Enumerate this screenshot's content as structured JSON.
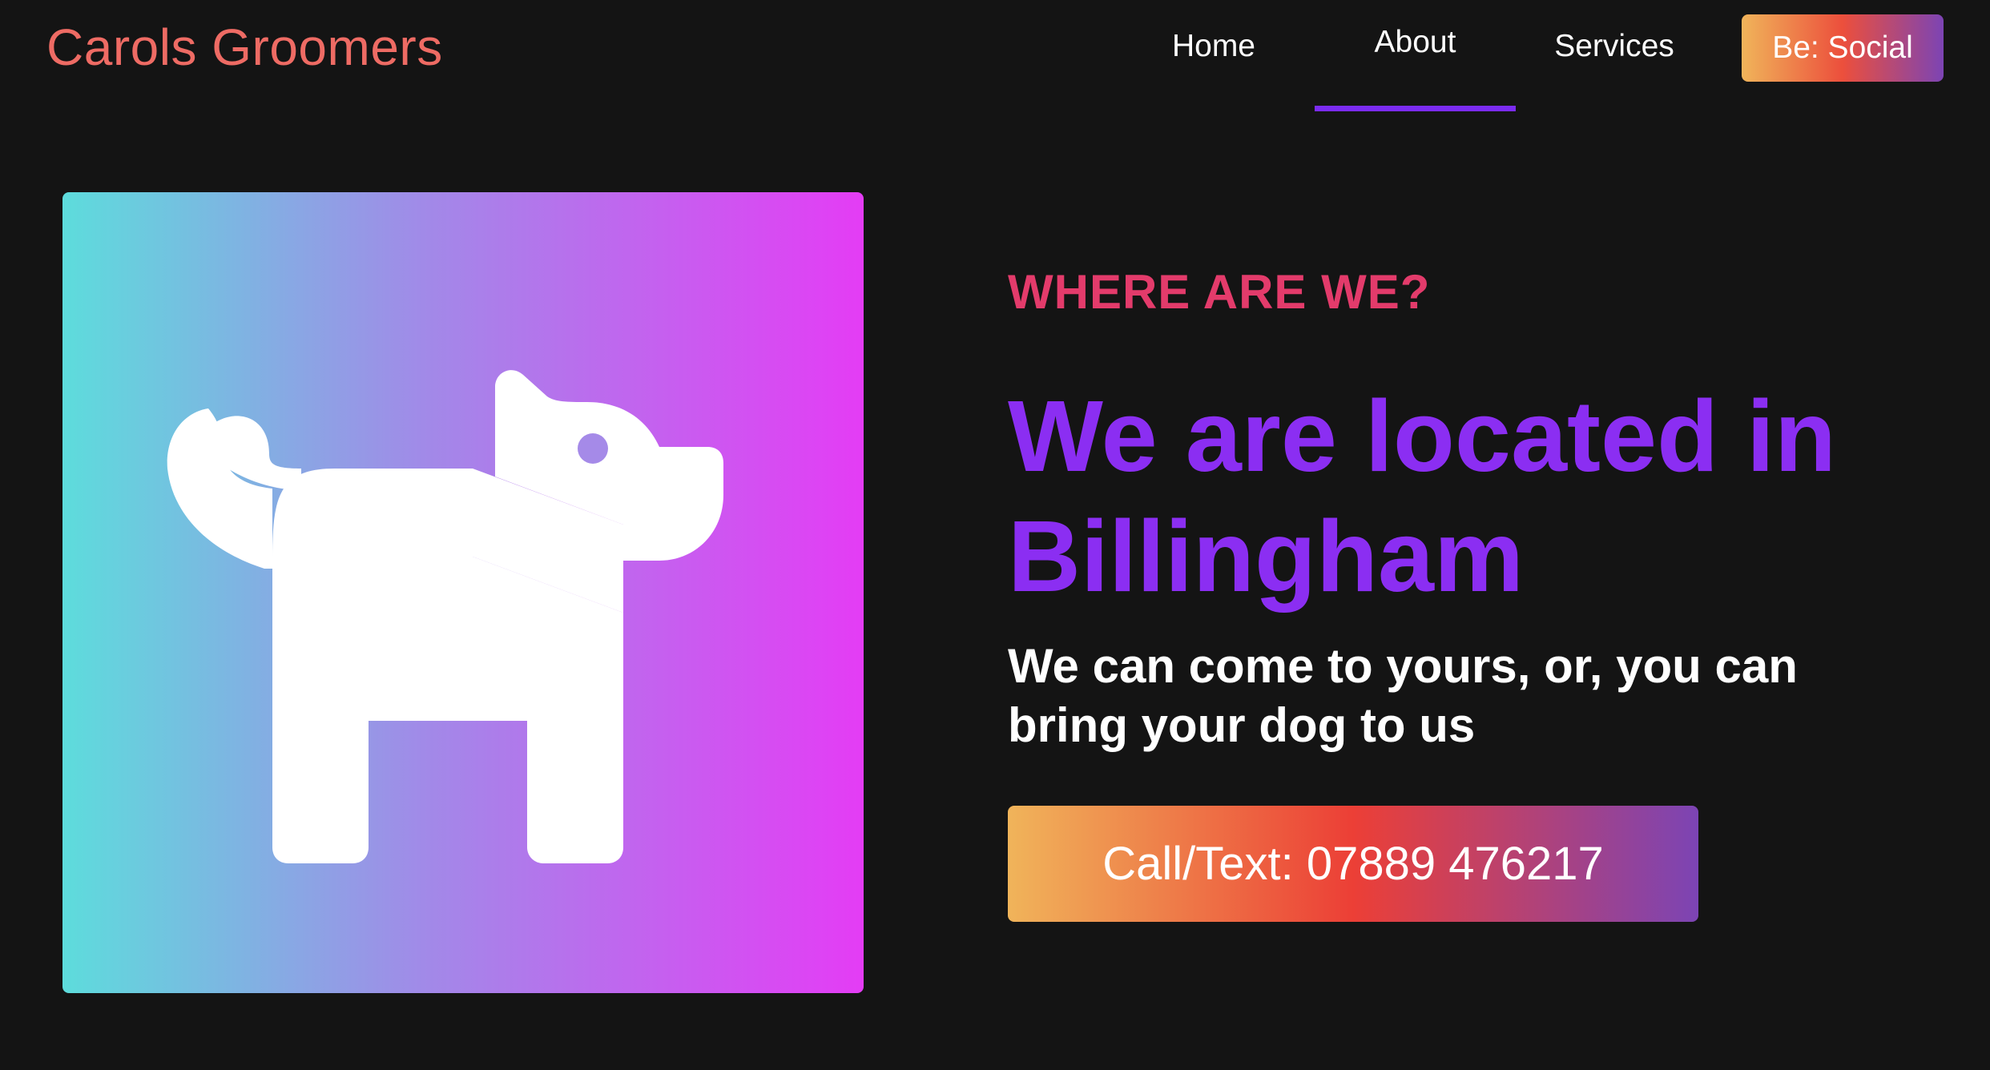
{
  "header": {
    "logo": "Carols Groomers",
    "nav": {
      "home": "Home",
      "about": "About",
      "services": "Services"
    },
    "social_button": "Be: Social",
    "active_nav": "About"
  },
  "hero": {
    "image_icon": "dog-icon",
    "eyebrow": "WHERE ARE WE?",
    "headline": "We are located in Billingham",
    "subhead": "We can come to yours, or, you can bring your dog to us",
    "call_button": "Call/Text: 07889 476217"
  },
  "colors": {
    "background": "#141414",
    "logo": "#ee6b64",
    "accent_purple": "#8b2ef2",
    "eyebrow_pink": "#e33b6b",
    "nav_underline": "#7b2cf2"
  }
}
